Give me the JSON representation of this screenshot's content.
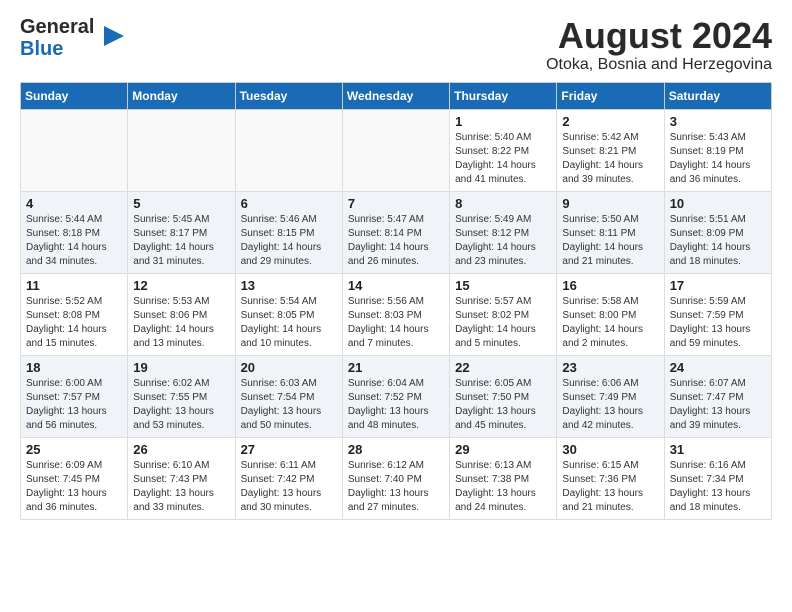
{
  "logo": {
    "line1": "General",
    "line2": "Blue",
    "arrow": "▶"
  },
  "title": "August 2024",
  "subtitle": "Otoka, Bosnia and Herzegovina",
  "days_header": [
    "Sunday",
    "Monday",
    "Tuesday",
    "Wednesday",
    "Thursday",
    "Friday",
    "Saturday"
  ],
  "weeks": [
    [
      {
        "day": "",
        "info": ""
      },
      {
        "day": "",
        "info": ""
      },
      {
        "day": "",
        "info": ""
      },
      {
        "day": "",
        "info": ""
      },
      {
        "day": "1",
        "info": "Sunrise: 5:40 AM\nSunset: 8:22 PM\nDaylight: 14 hours\nand 41 minutes."
      },
      {
        "day": "2",
        "info": "Sunrise: 5:42 AM\nSunset: 8:21 PM\nDaylight: 14 hours\nand 39 minutes."
      },
      {
        "day": "3",
        "info": "Sunrise: 5:43 AM\nSunset: 8:19 PM\nDaylight: 14 hours\nand 36 minutes."
      }
    ],
    [
      {
        "day": "4",
        "info": "Sunrise: 5:44 AM\nSunset: 8:18 PM\nDaylight: 14 hours\nand 34 minutes."
      },
      {
        "day": "5",
        "info": "Sunrise: 5:45 AM\nSunset: 8:17 PM\nDaylight: 14 hours\nand 31 minutes."
      },
      {
        "day": "6",
        "info": "Sunrise: 5:46 AM\nSunset: 8:15 PM\nDaylight: 14 hours\nand 29 minutes."
      },
      {
        "day": "7",
        "info": "Sunrise: 5:47 AM\nSunset: 8:14 PM\nDaylight: 14 hours\nand 26 minutes."
      },
      {
        "day": "8",
        "info": "Sunrise: 5:49 AM\nSunset: 8:12 PM\nDaylight: 14 hours\nand 23 minutes."
      },
      {
        "day": "9",
        "info": "Sunrise: 5:50 AM\nSunset: 8:11 PM\nDaylight: 14 hours\nand 21 minutes."
      },
      {
        "day": "10",
        "info": "Sunrise: 5:51 AM\nSunset: 8:09 PM\nDaylight: 14 hours\nand 18 minutes."
      }
    ],
    [
      {
        "day": "11",
        "info": "Sunrise: 5:52 AM\nSunset: 8:08 PM\nDaylight: 14 hours\nand 15 minutes."
      },
      {
        "day": "12",
        "info": "Sunrise: 5:53 AM\nSunset: 8:06 PM\nDaylight: 14 hours\nand 13 minutes."
      },
      {
        "day": "13",
        "info": "Sunrise: 5:54 AM\nSunset: 8:05 PM\nDaylight: 14 hours\nand 10 minutes."
      },
      {
        "day": "14",
        "info": "Sunrise: 5:56 AM\nSunset: 8:03 PM\nDaylight: 14 hours\nand 7 minutes."
      },
      {
        "day": "15",
        "info": "Sunrise: 5:57 AM\nSunset: 8:02 PM\nDaylight: 14 hours\nand 5 minutes."
      },
      {
        "day": "16",
        "info": "Sunrise: 5:58 AM\nSunset: 8:00 PM\nDaylight: 14 hours\nand 2 minutes."
      },
      {
        "day": "17",
        "info": "Sunrise: 5:59 AM\nSunset: 7:59 PM\nDaylight: 13 hours\nand 59 minutes."
      }
    ],
    [
      {
        "day": "18",
        "info": "Sunrise: 6:00 AM\nSunset: 7:57 PM\nDaylight: 13 hours\nand 56 minutes."
      },
      {
        "day": "19",
        "info": "Sunrise: 6:02 AM\nSunset: 7:55 PM\nDaylight: 13 hours\nand 53 minutes."
      },
      {
        "day": "20",
        "info": "Sunrise: 6:03 AM\nSunset: 7:54 PM\nDaylight: 13 hours\nand 50 minutes."
      },
      {
        "day": "21",
        "info": "Sunrise: 6:04 AM\nSunset: 7:52 PM\nDaylight: 13 hours\nand 48 minutes."
      },
      {
        "day": "22",
        "info": "Sunrise: 6:05 AM\nSunset: 7:50 PM\nDaylight: 13 hours\nand 45 minutes."
      },
      {
        "day": "23",
        "info": "Sunrise: 6:06 AM\nSunset: 7:49 PM\nDaylight: 13 hours\nand 42 minutes."
      },
      {
        "day": "24",
        "info": "Sunrise: 6:07 AM\nSunset: 7:47 PM\nDaylight: 13 hours\nand 39 minutes."
      }
    ],
    [
      {
        "day": "25",
        "info": "Sunrise: 6:09 AM\nSunset: 7:45 PM\nDaylight: 13 hours\nand 36 minutes."
      },
      {
        "day": "26",
        "info": "Sunrise: 6:10 AM\nSunset: 7:43 PM\nDaylight: 13 hours\nand 33 minutes."
      },
      {
        "day": "27",
        "info": "Sunrise: 6:11 AM\nSunset: 7:42 PM\nDaylight: 13 hours\nand 30 minutes."
      },
      {
        "day": "28",
        "info": "Sunrise: 6:12 AM\nSunset: 7:40 PM\nDaylight: 13 hours\nand 27 minutes."
      },
      {
        "day": "29",
        "info": "Sunrise: 6:13 AM\nSunset: 7:38 PM\nDaylight: 13 hours\nand 24 minutes."
      },
      {
        "day": "30",
        "info": "Sunrise: 6:15 AM\nSunset: 7:36 PM\nDaylight: 13 hours\nand 21 minutes."
      },
      {
        "day": "31",
        "info": "Sunrise: 6:16 AM\nSunset: 7:34 PM\nDaylight: 13 hours\nand 18 minutes."
      }
    ]
  ]
}
